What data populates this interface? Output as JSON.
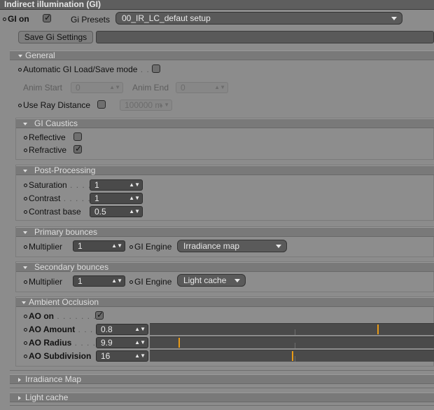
{
  "window": {
    "title": "Indirect illumination (GI)"
  },
  "top": {
    "gi_on_label": "GI on",
    "gi_on_checked": true,
    "presets_label": "Gi Presets",
    "presets_value": "00_IR_LC_defaut setup",
    "save_button": "Save Gi Settings"
  },
  "general": {
    "title": "General",
    "auto_load_save": "Automatic GI Load/Save mode",
    "auto_load_save_checked": false,
    "anim_start_label": "Anim Start",
    "anim_start_value": "0",
    "anim_end_label": "Anim End",
    "anim_end_value": "0",
    "use_ray_distance_label": "Use Ray Distance",
    "use_ray_distance_checked": false,
    "ray_distance_value": "100000 m"
  },
  "caustics": {
    "title": "GI Caustics",
    "reflective_label": "Reflective",
    "reflective_checked": false,
    "refractive_label": "Refractive",
    "refractive_checked": true
  },
  "post": {
    "title": "Post-Processing",
    "saturation_label": "Saturation",
    "saturation_value": "1",
    "contrast_label": "Contrast",
    "contrast_value": "1",
    "contrast_base_label": "Contrast base",
    "contrast_base_value": "0.5"
  },
  "primary": {
    "title": "Primary bounces",
    "multiplier_label": "Multiplier",
    "multiplier_value": "1",
    "engine_label": "GI Engine",
    "engine_value": "Irradiance map"
  },
  "secondary": {
    "title": "Secondary bounces",
    "multiplier_label": "Multiplier",
    "multiplier_value": "1",
    "engine_label": "GI Engine",
    "engine_value": "Light cache"
  },
  "ao": {
    "title": "Ambient Occlusion",
    "on_label": "AO on",
    "on_checked": true,
    "amount_label": "AO Amount",
    "amount_value": "0.8",
    "amount_slider": 0.8,
    "radius_label": "AO Radius",
    "radius_value": "9.9",
    "radius_slider": 0.1,
    "subdiv_label": "AO Subdivision",
    "subdiv_value": "16",
    "subdiv_slider": 0.5
  },
  "collapsed": {
    "irradiance_map": "Irradiance Map",
    "light_cache": "Light cache"
  },
  "colors": {
    "slider_thumb": "#e99b17",
    "dark_field": "#4a4a4a",
    "background": "#8c8c8c"
  }
}
